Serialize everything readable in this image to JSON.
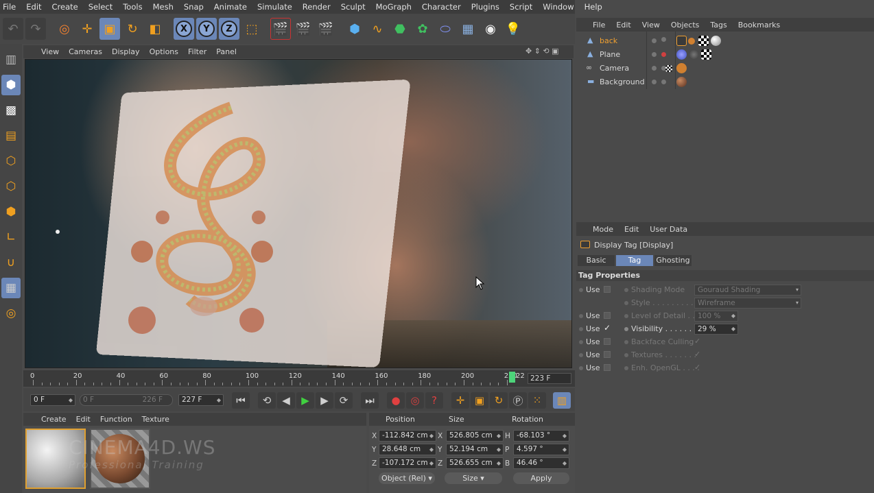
{
  "menubar": [
    "File",
    "Edit",
    "Create",
    "Select",
    "Tools",
    "Mesh",
    "Snap",
    "Animate",
    "Simulate",
    "Render",
    "Sculpt",
    "MoGraph",
    "Character",
    "Plugins",
    "Script",
    "Window",
    "Help"
  ],
  "toolbar": {
    "axis_x": "X",
    "axis_y": "Y",
    "axis_z": "Z"
  },
  "viewport": {
    "menu": [
      "View",
      "Cameras",
      "Display",
      "Options",
      "Filter",
      "Panel"
    ]
  },
  "timeline": {
    "ticks": [
      "0",
      "20",
      "40",
      "60",
      "80",
      "100",
      "120",
      "140",
      "160",
      "180",
      "200",
      "220"
    ],
    "current_marker": "22",
    "end_frame": "223 F"
  },
  "transport": {
    "start": "0 F",
    "range_start": "0 F",
    "range_end": "226 F",
    "end": "227 F"
  },
  "materials": {
    "menu": [
      "Create",
      "Edit",
      "Function",
      "Texture"
    ],
    "watermark": "CINEMA4D.WS",
    "watermark_sub": "Professional Training"
  },
  "coords": {
    "head_position": "Position",
    "head_size": "Size",
    "head_rotation": "Rotation",
    "rows": [
      {
        "pl": "X",
        "pv": "-112.842 cm",
        "sl": "X",
        "sv": "526.805 cm",
        "rl": "H",
        "rv": "-68.103 °"
      },
      {
        "pl": "Y",
        "pv": "28.648 cm",
        "sl": "Y",
        "sv": "52.194 cm",
        "rl": "P",
        "rv": "4.597 °"
      },
      {
        "pl": "Z",
        "pv": "-107.172 cm",
        "sl": "Z",
        "sv": "526.655 cm",
        "rl": "B",
        "rv": "46.46 °"
      }
    ],
    "mode": "Object (Rel)",
    "size_mode": "Size",
    "apply": "Apply"
  },
  "objects": {
    "menu": [
      "File",
      "Edit",
      "View",
      "Objects",
      "Tags",
      "Bookmarks"
    ],
    "items": [
      {
        "name": "back",
        "selected": true
      },
      {
        "name": "Plane",
        "selected": false
      },
      {
        "name": "Camera",
        "selected": false
      },
      {
        "name": "Background",
        "selected": false
      }
    ]
  },
  "attributes": {
    "menu": [
      "Mode",
      "Edit",
      "User Data"
    ],
    "title": "Display Tag [Display]",
    "tabs": [
      "Basic",
      "Tag",
      "Ghosting"
    ],
    "section": "Tag Properties",
    "use_label": "Use",
    "props": {
      "shading_mode": "Shading Mode",
      "shading_mode_value": "Gouraud Shading",
      "style": "Style . . . . . . . . .",
      "style_value": "Wireframe",
      "lod": "Level of Detail . .",
      "lod_value": "100 %",
      "visibility": "Visibility . . . . . . .",
      "visibility_value": "29 %",
      "backface": "Backface Culling",
      "textures": "Textures . . . . . . .",
      "opengl": "Enh. OpenGL . . . ."
    },
    "check": "✓"
  },
  "colors": {
    "accent": "#6b87b8",
    "selected_text": "#f0a030"
  }
}
